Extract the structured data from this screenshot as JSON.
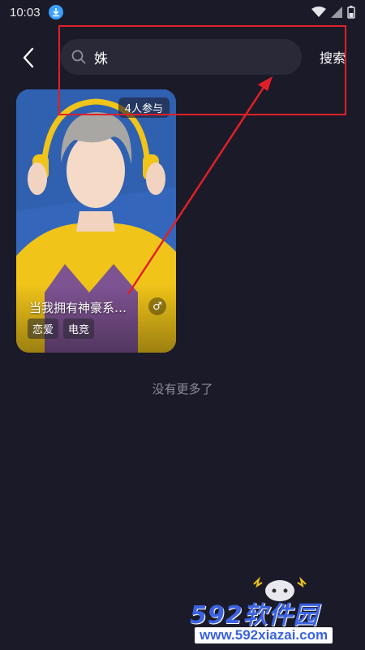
{
  "status_bar": {
    "time": "10:03",
    "download_icon": "download-icon",
    "wifi_icon": "wifi-icon",
    "signal_icon": "signal-icon",
    "battery_icon": "battery-icon"
  },
  "header": {
    "back_icon": "chevron-left-icon",
    "search_icon": "search-icon",
    "search_value": "姝",
    "search_button_label": "搜索"
  },
  "card": {
    "participants": "4人参与",
    "title": "当我拥有神豪系…",
    "gender_icon": "male-icon",
    "gender_symbol": "♂",
    "tags": [
      "恋爱",
      "电竞"
    ]
  },
  "footer": {
    "no_more_text": "没有更多了"
  },
  "watermark": {
    "main": "592软件园",
    "sub": "www.592xiazai.com"
  },
  "colors": {
    "background": "#1b1a28",
    "search_box": "#2a2938",
    "annotation_red": "#e02028",
    "watermark_blue": "#3b62e0"
  }
}
